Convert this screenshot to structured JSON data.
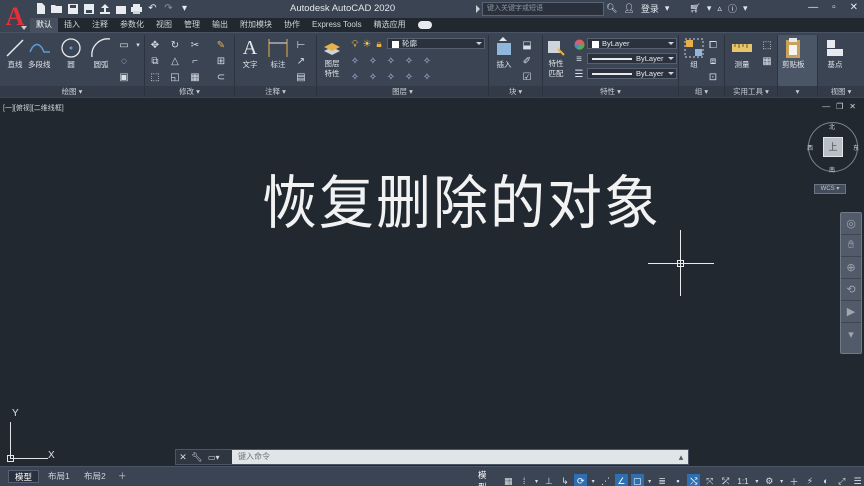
{
  "app": {
    "logo_letter": "A",
    "title": "Autodesk AutoCAD 2020",
    "search_placeholder": "键入关键字或短语",
    "login_label": "登录"
  },
  "ribbon_tabs": [
    "默认",
    "插入",
    "注释",
    "参数化",
    "视图",
    "管理",
    "输出",
    "附加模块",
    "协作",
    "Express Tools",
    "精选应用"
  ],
  "active_tab_index": 0,
  "panels": {
    "draw": {
      "label": "绘图",
      "line": "直线",
      "polyline": "多段线",
      "circle": "圆",
      "arc": "圆弧"
    },
    "modify": {
      "label": "修改"
    },
    "annotation": {
      "label": "注释",
      "text": "文字",
      "dimension": "标注"
    },
    "layers": {
      "label": "图层",
      "layer_properties": "图层\n特性",
      "layer_current": "轮廓"
    },
    "block": {
      "label": "块",
      "insert": "插入"
    },
    "properties": {
      "label": "特性",
      "match": "特性\n匹配",
      "color": "ByLayer",
      "linetype": "ByLayer",
      "lineweight": "ByLayer"
    },
    "groups": {
      "label": "组",
      "group": "组"
    },
    "utilities": {
      "label": "实用工具",
      "measure": "测量"
    },
    "clipboard": {
      "label": "剪贴板",
      "paste": "剪贴板"
    },
    "view": {
      "label": "视图",
      "base": "基点"
    }
  },
  "viewport": {
    "label": "[一][俯视][二维线框]",
    "main_text": "恢复删除的对象",
    "viewcube": {
      "north": "北",
      "south": "南",
      "west": "西",
      "east": "东",
      "face": "上",
      "wcs": "WCS"
    },
    "ucs_x": "X",
    "ucs_y": "Y"
  },
  "command_line": {
    "placeholder": "键入命令"
  },
  "layout_tabs": [
    "模型",
    "布局1",
    "布局2"
  ],
  "active_layout_index": 0,
  "status": {
    "model_label": "模型",
    "scale": "1:1"
  },
  "colors": {
    "background": "#212830",
    "ribbon": "#3b4453",
    "accent": "#2d6fb0",
    "logo_red": "#e0303a"
  }
}
